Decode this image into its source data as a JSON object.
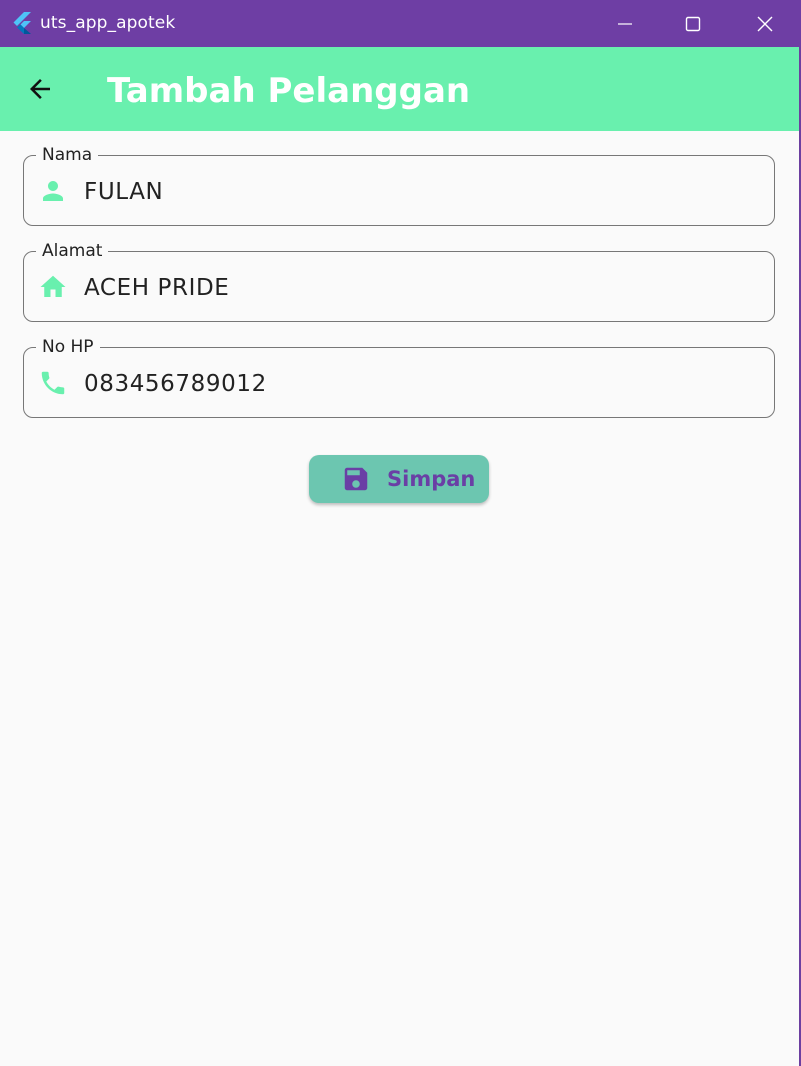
{
  "window": {
    "title": "uts_app_apotek",
    "titlebar_color": "#6e3ea4"
  },
  "appbar": {
    "title": "Tambah Pelanggan",
    "color": "#69f0ae",
    "back_icon": "arrow-left-icon"
  },
  "form": {
    "fields": [
      {
        "label": "Nama",
        "value": "FULAN",
        "icon": "person-icon"
      },
      {
        "label": "Alamat",
        "value": "ACEH PRIDE",
        "icon": "home-icon"
      },
      {
        "label": "No HP",
        "value": "083456789012",
        "icon": "phone-icon"
      }
    ],
    "icon_color": "#69f0ae",
    "save_button": {
      "label": "Simpan",
      "icon": "save-icon",
      "background": "#6cc6b0",
      "text_color": "#6a3fa5"
    }
  }
}
